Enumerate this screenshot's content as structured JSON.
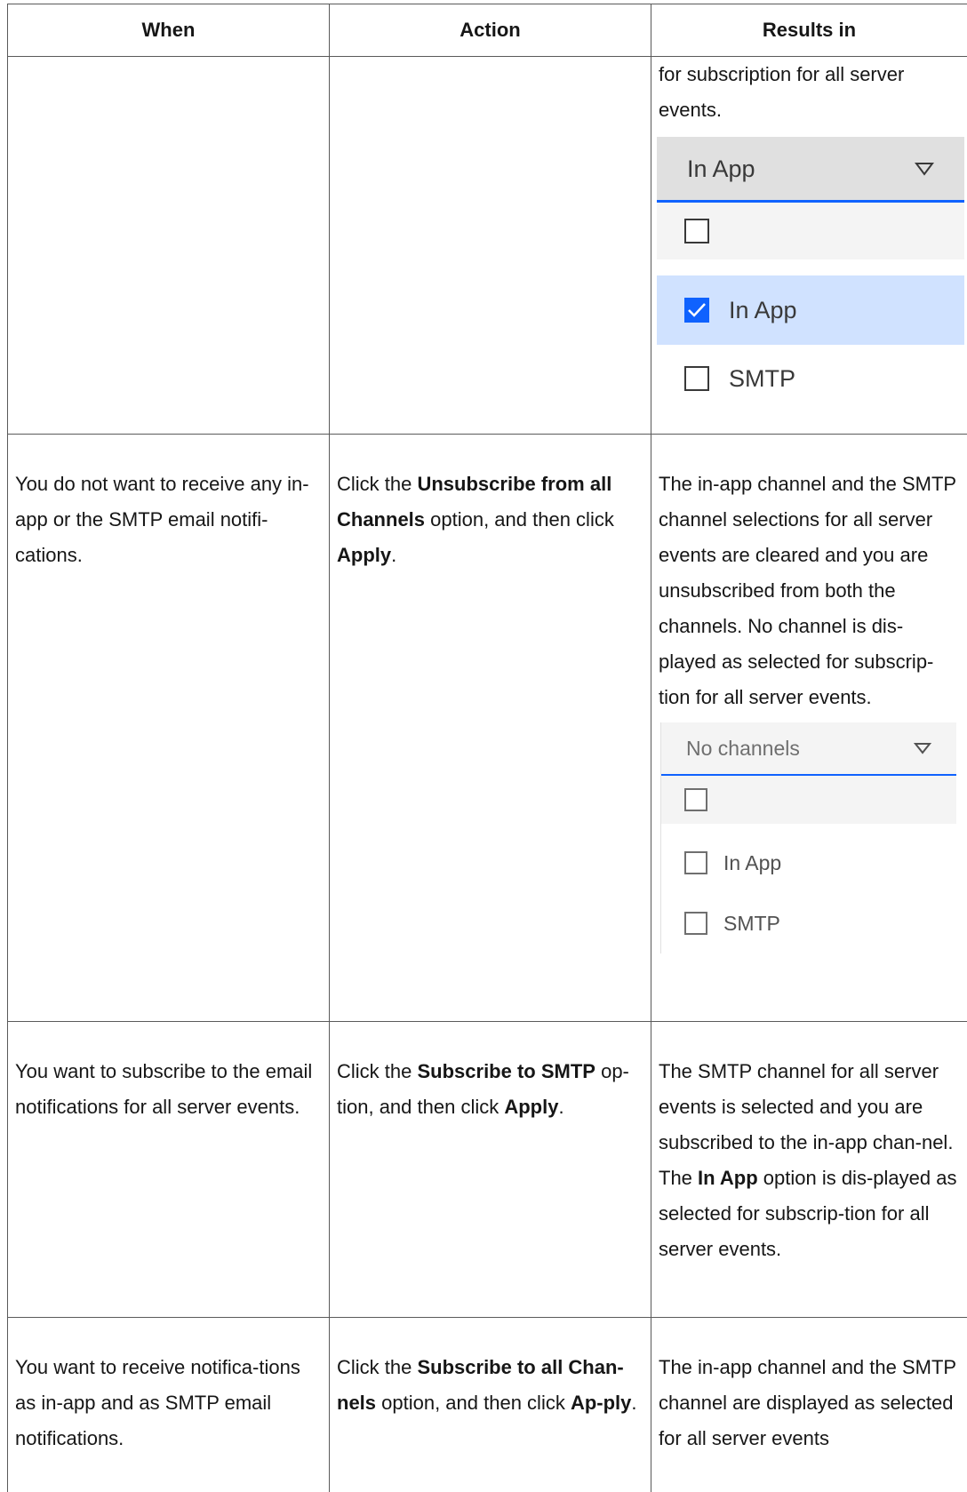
{
  "table": {
    "headers": [
      "When",
      "Action",
      "Results in"
    ],
    "row1": {
      "results_text": "for subscription for all server events.",
      "dropdown": {
        "selected_label": "In App",
        "options": [
          "In App",
          "SMTP"
        ]
      }
    },
    "row2": {
      "when": "You do not want to receive any in-app or the SMTP email notifi-cations.",
      "action_pre": "Click the ",
      "action_bold1": "Unsubscribe from all Channels",
      "action_mid": " option, and then click ",
      "action_bold2": "Apply",
      "action_post": ".",
      "results_text": "The in-app channel and the SMTP channel selections for all server events are cleared and you are unsubscribed from both the channels. No channel is dis-played as selected for subscrip-tion for all server events.",
      "dropdown": {
        "selected_label": "No channels",
        "options": [
          "In App",
          "SMTP"
        ]
      }
    },
    "row3": {
      "when": "You want to subscribe to the email notifications for all server events.",
      "action_pre": "Click the ",
      "action_bold1": "Subscribe to SMTP",
      "action_mid": " op-tion, and then click ",
      "action_bold2": "Apply",
      "action_post": ".",
      "results_pre": "The SMTP channel for all server events is selected and you are subscribed to the in-app chan-nel. The ",
      "results_bold": "In App",
      "results_post": " option is dis-played as selected for subscrip-tion for all server events."
    },
    "row4": {
      "when": "You want to receive notifica-tions as in-app and as SMTP email notifications.",
      "action_pre": "Click the ",
      "action_bold1": "Subscribe to all Chan-nels",
      "action_mid": " option, and then click ",
      "action_bold2": "Ap-ply",
      "action_post": ".",
      "results_text": "The in-app channel and the SMTP channel are displayed as selected for all server events"
    }
  },
  "colors": {
    "accent": "#0f62fe",
    "selected_row": "#d0e2ff",
    "field_bg": "#e0e0e0"
  }
}
